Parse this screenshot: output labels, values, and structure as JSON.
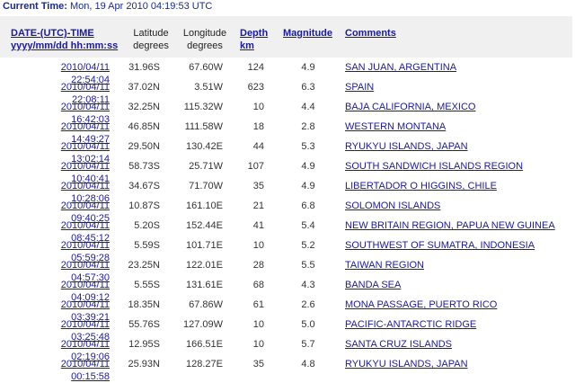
{
  "current_time": {
    "label": "Current Time:",
    "value": "Mon, 19 Apr 2010 04:19:53 UTC"
  },
  "headers": {
    "date_line1": "DATE-(UTC)-TIME",
    "date_line2": "yyyy/mm/dd hh:mm:ss",
    "lat_line1": "Latitude",
    "lat_line2": "degrees",
    "lon_line1": "Longitude",
    "lon_line2": "degrees",
    "depth_line1": "Depth",
    "depth_line2": "km",
    "magnitude": "Magnitude",
    "comments": "Comments"
  },
  "rows": [
    {
      "date": "2010/04/11  22:54:04",
      "lat": "31.96S",
      "lon": "67.60W",
      "depth": "124",
      "mag": "4.9",
      "comment": "SAN JUAN, ARGENTINA"
    },
    {
      "date": "2010/04/11  22:08:11",
      "lat": "37.02N",
      "lon": "3.51W",
      "depth": "623",
      "mag": "6.3",
      "comment": "SPAIN"
    },
    {
      "date": "2010/04/11  16:42:03",
      "lat": "32.25N",
      "lon": "115.32W",
      "depth": "10",
      "mag": "4.4",
      "comment": "BAJA CALIFORNIA, MEXICO"
    },
    {
      "date": "2010/04/11  14:49:27",
      "lat": "46.85N",
      "lon": "111.58W",
      "depth": "18",
      "mag": "2.8",
      "comment": "WESTERN MONTANA"
    },
    {
      "date": "2010/04/11  13:02:14",
      "lat": "29.50N",
      "lon": "130.42E",
      "depth": "44",
      "mag": "5.3",
      "comment": "RYUKYU ISLANDS, JAPAN"
    },
    {
      "date": "2010/04/11  10:40:41",
      "lat": "58.73S",
      "lon": "25.71W",
      "depth": "107",
      "mag": "4.9",
      "comment": "SOUTH SANDWICH ISLANDS REGION"
    },
    {
      "date": "2010/04/11  10:28:06",
      "lat": "34.67S",
      "lon": "71.70W",
      "depth": "35",
      "mag": "4.9",
      "comment": "LIBERTADOR O HIGGINS, CHILE"
    },
    {
      "date": "2010/04/11  09:40:25",
      "lat": "10.87S",
      "lon": "161.10E",
      "depth": "21",
      "mag": "6.8",
      "comment": "SOLOMON ISLANDS"
    },
    {
      "date": "2010/04/11  08:45:12",
      "lat": "5.20S",
      "lon": "152.44E",
      "depth": "41",
      "mag": "5.4",
      "comment": "NEW BRITAIN REGION, PAPUA NEW GUINEA"
    },
    {
      "date": "2010/04/11  05:59:28",
      "lat": "5.59S",
      "lon": "101.71E",
      "depth": "10",
      "mag": "5.2",
      "comment": "SOUTHWEST OF SUMATRA, INDONESIA"
    },
    {
      "date": "2010/04/11  04:57:30",
      "lat": "23.25N",
      "lon": "122.01E",
      "depth": "28",
      "mag": "5.5",
      "comment": "TAIWAN REGION"
    },
    {
      "date": "2010/04/11  04:09:12",
      "lat": "5.55S",
      "lon": "131.61E",
      "depth": "68",
      "mag": "4.3",
      "comment": "BANDA SEA"
    },
    {
      "date": "2010/04/11  03:39:21",
      "lat": "18.35N",
      "lon": "67.86W",
      "depth": "61",
      "mag": "2.6",
      "comment": "MONA PASSAGE, PUERTO RICO"
    },
    {
      "date": "2010/04/11  03:25:48",
      "lat": "55.76S",
      "lon": "127.09W",
      "depth": "10",
      "mag": "5.0",
      "comment": "PACIFIC-ANTARCTIC RIDGE"
    },
    {
      "date": "2010/04/11  02:19:06",
      "lat": "12.95S",
      "lon": "166.51E",
      "depth": "10",
      "mag": "5.7",
      "comment": "SANTA CRUZ ISLANDS"
    },
    {
      "date": "2010/04/11  00:15:58",
      "lat": "25.93N",
      "lon": "128.27E",
      "depth": "35",
      "mag": "4.8",
      "comment": "RYUKYU ISLANDS, JAPAN"
    }
  ],
  "colors": {
    "link": "#1a1a9a",
    "header_bg": "#f0f0f0",
    "title": "#1a2a8a"
  }
}
